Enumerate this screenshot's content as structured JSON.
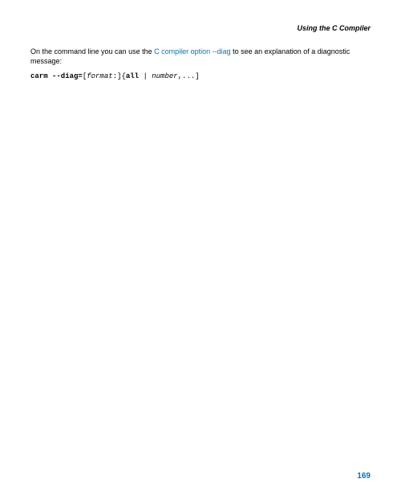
{
  "header": {
    "title": "Using the C Compiler"
  },
  "body": {
    "p1_a": "On the command line you can use the ",
    "p1_link": "C compiler option --diag",
    "p1_b": " to see an explanation of a diagnostic message:"
  },
  "code": {
    "cmd": "carm --diag=",
    "lb": "[",
    "fmt": "format",
    "colon": ":",
    "rb": "]",
    "lc": "{",
    "all": "all",
    "pipe": " | ",
    "num": "number",
    "tail": ",...]"
  },
  "footer": {
    "page": "169"
  }
}
